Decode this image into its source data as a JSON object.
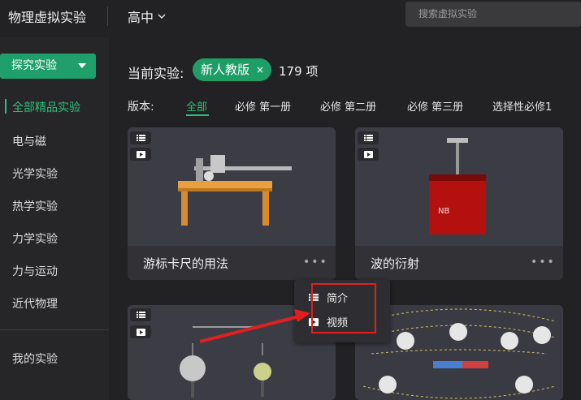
{
  "header": {
    "app_title": "物理虚拟实验",
    "level": "高中",
    "search_placeholder": "搜索虚拟实验"
  },
  "sidebar": {
    "explore_button": "探究实验",
    "items": [
      {
        "label": "全部精品实验",
        "active": true
      },
      {
        "label": "电与磁"
      },
      {
        "label": "光学实验"
      },
      {
        "label": "热学实验"
      },
      {
        "label": "力学实验"
      },
      {
        "label": "力与运动"
      },
      {
        "label": "近代物理"
      }
    ],
    "my_experiments": "我的实验"
  },
  "filter": {
    "current_label": "当前实验:",
    "chip": "新人教版",
    "chip_close": "×",
    "count": "179 项",
    "version_label": "版本:",
    "versions": [
      "全部",
      "必修 第一册",
      "必修 第二册",
      "必修 第三册",
      "选择性必修1"
    ]
  },
  "cards": [
    {
      "title": "游标卡尺的用法"
    },
    {
      "title": "波的衍射"
    },
    {
      "title": ""
    },
    {
      "title": ""
    }
  ],
  "card_more": "•••",
  "popup": {
    "items": [
      {
        "label": "简介",
        "icon": "list-icon"
      },
      {
        "label": "视频",
        "icon": "video-icon"
      }
    ]
  },
  "device_label": "NB",
  "colors": {
    "accent": "#1fa06a",
    "accent_text": "#2bbf7c",
    "highlight": "#e02020"
  }
}
